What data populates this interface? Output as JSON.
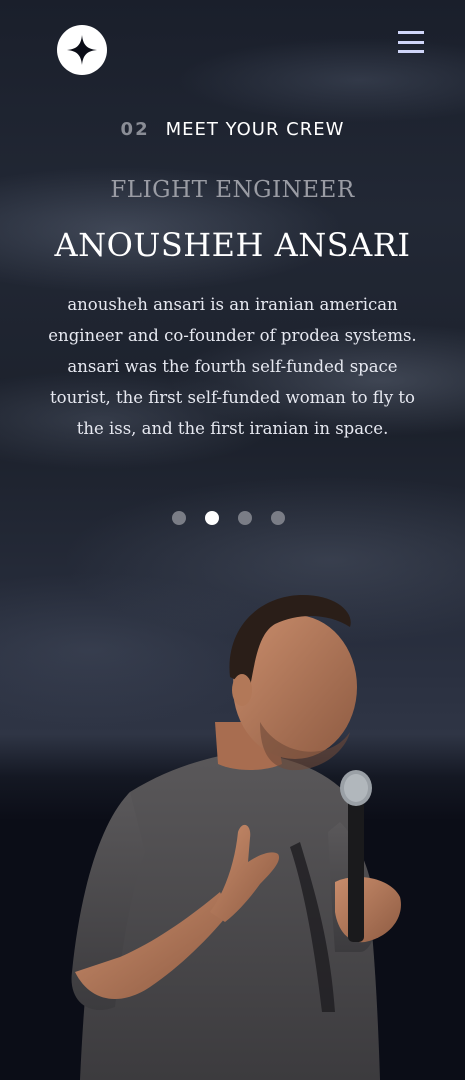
{
  "header": {
    "logo_icon": "star-logo-icon",
    "menu_icon": "hamburger-menu-icon"
  },
  "page": {
    "number": "02",
    "title": "MEET YOUR CREW"
  },
  "crew": {
    "role": "FLIGHT ENGINEER",
    "name": "ANOUSHEH ANSARI",
    "bio": "anousheh ansari is an iranian american engineer and co-founder of prodea systems. ansari was the fourth self-funded space tourist, the first self-funded woman to fly to the iss, and the first iranian in space."
  },
  "carousel": {
    "total": 4,
    "active_index": 1
  },
  "colors": {
    "background": "#0b0d17",
    "accent": "#d0d6f9",
    "text_muted": "#9a9ca4"
  }
}
